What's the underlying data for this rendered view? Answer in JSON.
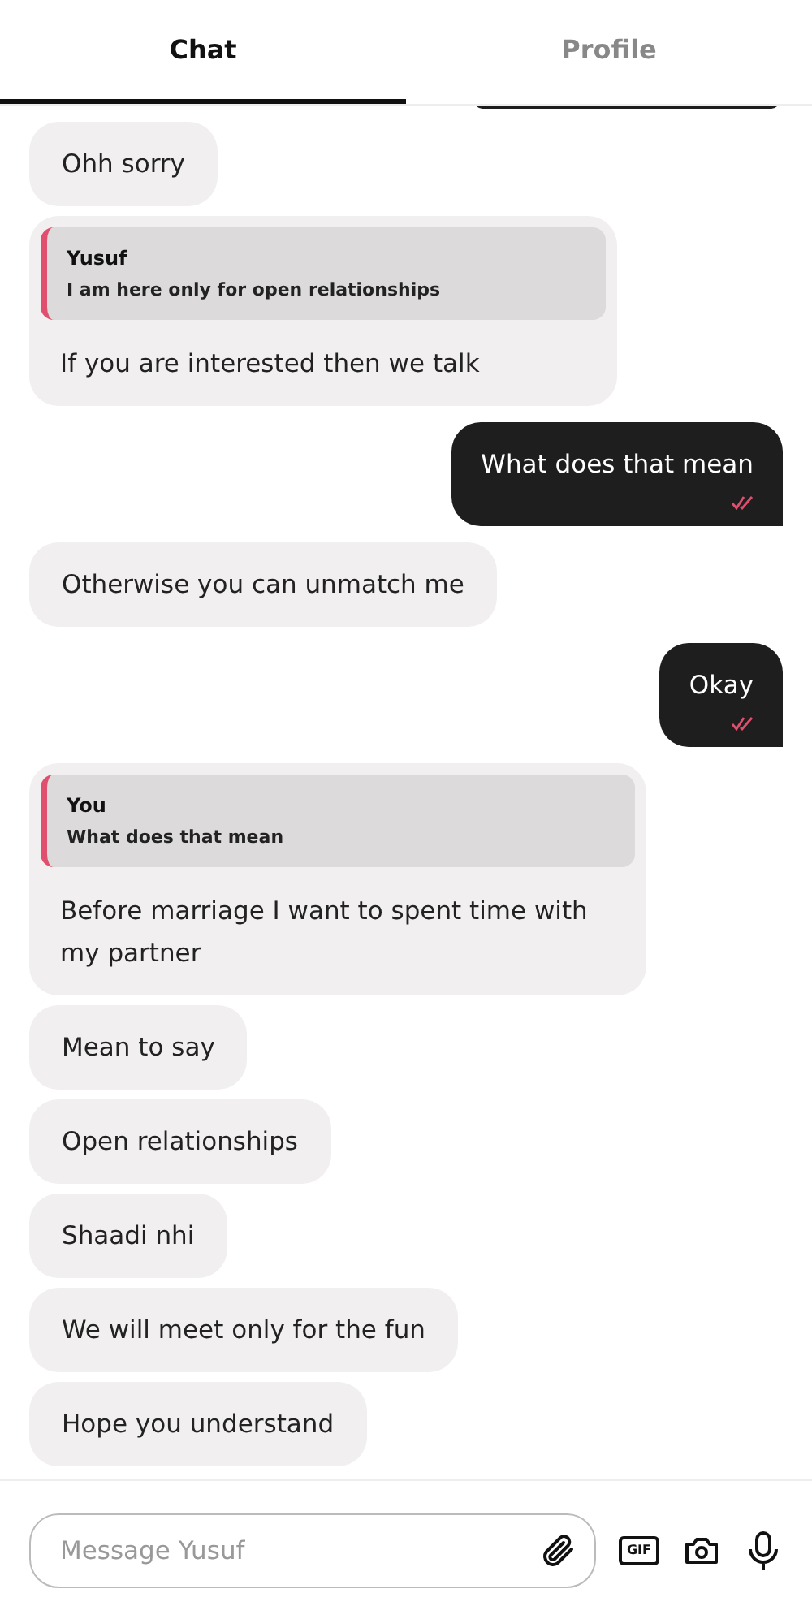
{
  "tabs": [
    {
      "label": "Chat",
      "selected": true
    },
    {
      "label": "Profile",
      "selected": false
    }
  ],
  "messages": [
    {
      "kind": "text",
      "sent": false,
      "text": "Ohh sorry"
    },
    {
      "kind": "reply",
      "sent": false,
      "quote_author": "Yusuf",
      "quote_text": "I am here only for open relationships",
      "text": "If you are interested then we talk"
    },
    {
      "kind": "text",
      "sent": true,
      "text": "What does that mean",
      "read": true
    },
    {
      "kind": "text",
      "sent": false,
      "text": "Otherwise you can unmatch  me"
    },
    {
      "kind": "text",
      "sent": true,
      "text": "Okay",
      "read": true
    },
    {
      "kind": "reply",
      "sent": false,
      "quote_author": "You",
      "quote_text": "What does that mean",
      "text": "Before marriage I want to spent time with my partner"
    },
    {
      "kind": "text",
      "sent": false,
      "text": "Mean to say"
    },
    {
      "kind": "text",
      "sent": false,
      "text": "Open relationships"
    },
    {
      "kind": "text",
      "sent": false,
      "text": "Shaadi nhi"
    },
    {
      "kind": "text",
      "sent": false,
      "text": "We will meet only for the fun"
    },
    {
      "kind": "text",
      "sent": false,
      "text": "Hope you understand"
    }
  ],
  "composer": {
    "placeholder": "Message Yusuf",
    "gif_label": "GIF"
  }
}
